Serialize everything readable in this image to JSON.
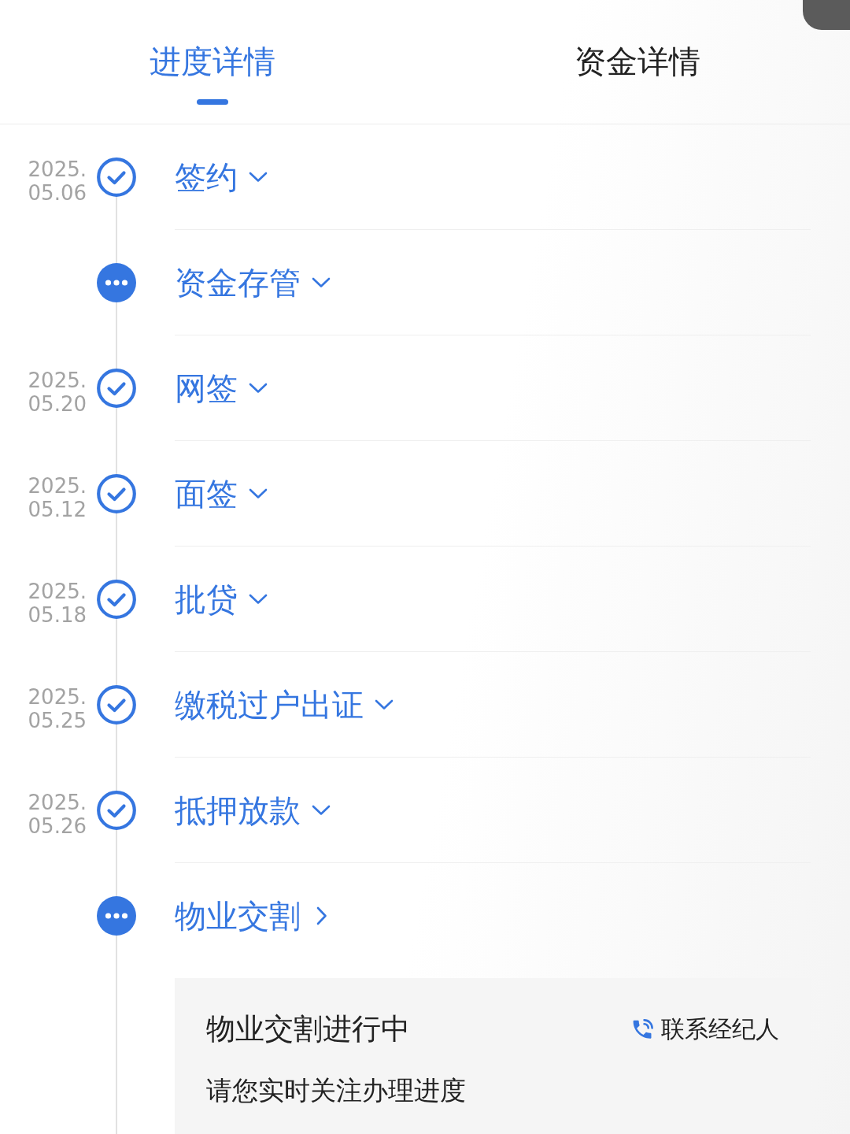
{
  "tabs": [
    {
      "label": "进度详情",
      "selected": true
    },
    {
      "label": "资金详情",
      "selected": false
    }
  ],
  "timeline": [
    {
      "completed": true,
      "year": "2025.",
      "day": "05.06",
      "title": "签约",
      "kind": "expandable"
    },
    {
      "completed": false,
      "title": "资金存管",
      "kind": "expandable"
    },
    {
      "completed": true,
      "year": "2025.",
      "day": "05.20",
      "title": "网签",
      "kind": "expandable"
    },
    {
      "completed": true,
      "year": "2025.",
      "day": "05.12",
      "title": "面签",
      "kind": "expandable"
    },
    {
      "completed": true,
      "year": "2025.",
      "day": "05.18",
      "title": "批贷",
      "kind": "expandable"
    },
    {
      "completed": true,
      "year": "2025.",
      "day": "05.25",
      "title": "缴税过户出证",
      "kind": "expandable"
    },
    {
      "completed": true,
      "year": "2025.",
      "day": "05.26",
      "title": "抵押放款",
      "kind": "expandable"
    },
    {
      "completed": false,
      "title": "物业交割",
      "kind": "link",
      "detail": {
        "title": "物业交割进行中",
        "contact": "联系经纪人",
        "note": "请您实时关注办理进度"
      }
    }
  ]
}
